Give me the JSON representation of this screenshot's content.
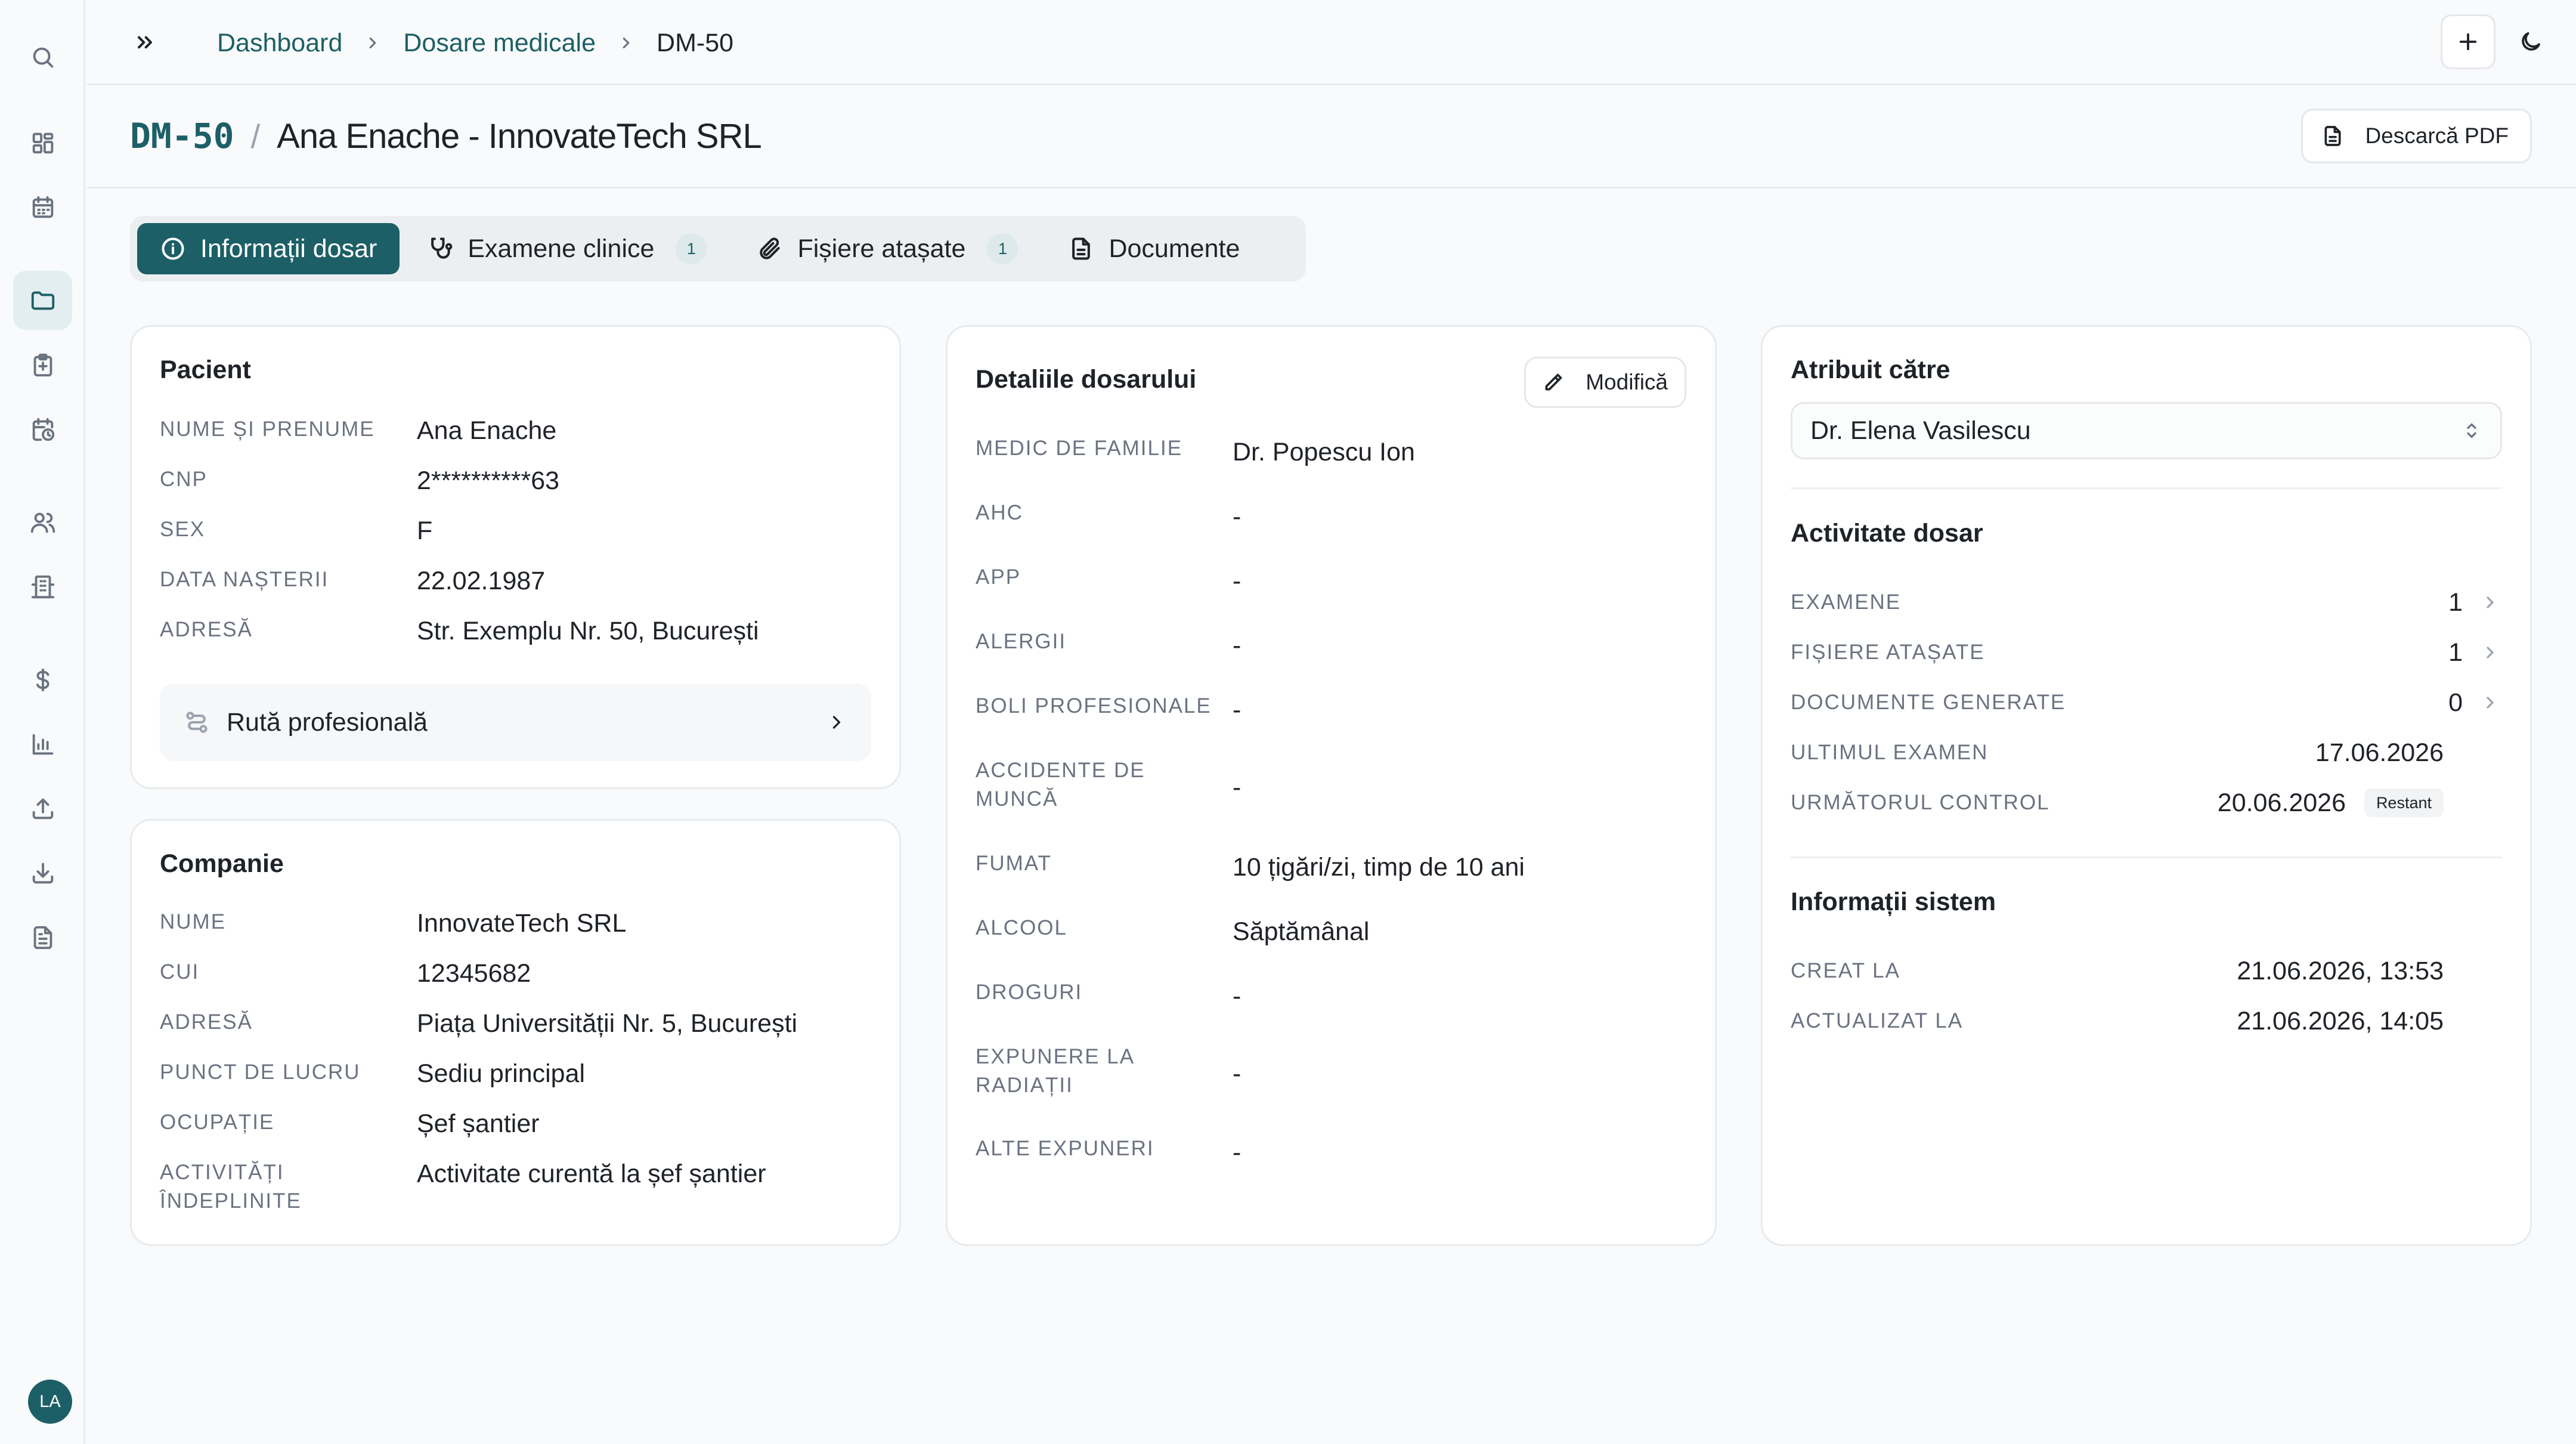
{
  "breadcrumb": {
    "items": [
      "Dashboard",
      "Dosare medicale"
    ],
    "current": "DM-50"
  },
  "header": {
    "case_id": "DM-50",
    "separator": "/",
    "title": "Ana Enache - InnovateTech SRL",
    "pdf_button": "Descarcă PDF"
  },
  "tabs": [
    {
      "label": "Informații dosar",
      "active": true,
      "icon": "info-icon"
    },
    {
      "label": "Examene clinice",
      "badge": "1",
      "icon": "stethoscope-icon"
    },
    {
      "label": "Fișiere atașate",
      "badge": "1",
      "icon": "paperclip-icon"
    },
    {
      "label": "Documente",
      "icon": "document-icon"
    }
  ],
  "patient": {
    "title": "Pacient",
    "rows": [
      {
        "label": "Nume și prenume",
        "value": "Ana Enache"
      },
      {
        "label": "CNP",
        "value": "2**********63"
      },
      {
        "label": "Sex",
        "value": "F"
      },
      {
        "label": "Data nașterii",
        "value": "22.02.1987"
      },
      {
        "label": "Adresă",
        "value": "Str. Exemplu Nr. 50, București"
      }
    ],
    "route_label": "Rută profesională"
  },
  "company": {
    "title": "Companie",
    "rows": [
      {
        "label": "Nume",
        "value": "InnovateTech SRL"
      },
      {
        "label": "CUI",
        "value": "12345682"
      },
      {
        "label": "Adresă",
        "value": "Piața Universității Nr. 5, București"
      },
      {
        "label": "Punct de lucru",
        "value": "Sediu principal"
      },
      {
        "label": "Ocupație",
        "value": "Șef șantier"
      },
      {
        "label": "Activități îndeplinite",
        "value": "Activitate curentă la șef șantier"
      }
    ]
  },
  "details": {
    "title": "Detaliile dosarului",
    "edit_button": "Modifică",
    "rows": [
      {
        "label": "Medic de familie",
        "value": "Dr. Popescu Ion"
      },
      {
        "label": "AHC",
        "value": "-"
      },
      {
        "label": "APP",
        "value": "-"
      },
      {
        "label": "Alergii",
        "value": "-"
      },
      {
        "label": "Boli profesionale",
        "value": "-"
      },
      {
        "label": "Accidente de muncă",
        "value": "-"
      },
      {
        "label": "Fumat",
        "value": "10 țigări/zi, timp de 10 ani"
      },
      {
        "label": "Alcool",
        "value": "Săptămânal"
      },
      {
        "label": "Droguri",
        "value": "-"
      },
      {
        "label": "Expunere la radiații",
        "value": "-"
      },
      {
        "label": "Alte expuneri",
        "value": "-"
      }
    ]
  },
  "assigned": {
    "title": "Atribuit către",
    "selected": "Dr. Elena Vasilescu"
  },
  "activity": {
    "title": "Activitate dosar",
    "rows": [
      {
        "label": "Examene",
        "value": "1"
      },
      {
        "label": "Fișiere atașate",
        "value": "1"
      },
      {
        "label": "Documente generate",
        "value": "0"
      },
      {
        "label": "Ultimul examen",
        "value": "17.06.2026"
      },
      {
        "label": "Următorul control",
        "value": "20.06.2026",
        "status": "Restant"
      }
    ]
  },
  "system": {
    "title": "Informații sistem",
    "rows": [
      {
        "label": "Creat la",
        "value": "21.06.2026, 13:53"
      },
      {
        "label": "Actualizat la",
        "value": "21.06.2026, 14:05"
      }
    ]
  },
  "user": {
    "initials": "LA"
  },
  "colors": {
    "accent": "#1d5f66",
    "accent_soft": "#e3eef0",
    "muted": "#6b7280"
  }
}
